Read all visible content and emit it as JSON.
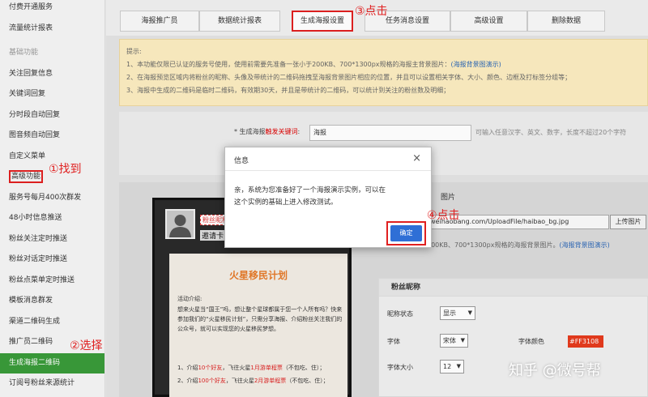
{
  "sidebar": {
    "items": [
      {
        "label": "付费开通服务"
      },
      {
        "label": "流量统计报表"
      },
      {
        "label": "基础功能"
      },
      {
        "label": "关注回复信息"
      },
      {
        "label": "关键词回复"
      },
      {
        "label": "分时段自动回复"
      },
      {
        "label": "图音频自动回复"
      },
      {
        "label": "自定义菜单"
      },
      {
        "label": "高级功能"
      },
      {
        "label": "服务号每月400次群发"
      },
      {
        "label": "48小时信息推送"
      },
      {
        "label": "粉丝关注定时推送"
      },
      {
        "label": "粉丝对话定时推送"
      },
      {
        "label": "粉丝点菜单定时推送"
      },
      {
        "label": "模板消息群发"
      },
      {
        "label": "渠道二维码生成"
      },
      {
        "label": "推广员二维码"
      },
      {
        "label": "生成海报二维码"
      },
      {
        "label": "订阅号粉丝来源统计"
      }
    ]
  },
  "tabs": [
    {
      "label": "海报推广员"
    },
    {
      "label": "数据统计报表"
    },
    {
      "label": "生成海报设置"
    },
    {
      "label": "任务消息设置"
    },
    {
      "label": "高级设置"
    },
    {
      "label": "删除数据"
    }
  ],
  "notice": {
    "title": "提示:",
    "line1": "1、本功能仅限已认证的服务号使用，使用前需要先准备一张小于200KB、700*1300px规格的海报主背景图片：",
    "line1_link": "(海报背景图演示)",
    "line2": "2、在海报预览区域内将粉丝的昵称、头像及带统计的二维码拖拽至海报背景图片相应的位置，并且可以设置相关字体、大小、颜色、边框及打标签分组等；",
    "line3": "3、海报中生成的二维码是临时二维码，有效期30天，并且是带统计的二维码，可以统计到关注的粉丝数及明细；"
  },
  "keyword": {
    "label_prefix": "* 生成海报",
    "label_highlight": "触发关键词",
    "label_suffix": ":",
    "value": "海报",
    "hint": "可输入任意汉字、英文、数字，长度不超过20个字符"
  },
  "background": {
    "label": "图片",
    "url": "weihaobang.com/UploadFile/haibao_bg.jpg",
    "upload_label": "上传图片",
    "size_hint": "200KB、700*1300px规格的海报背景图片。",
    "size_link": "(海报背景图演示)"
  },
  "poster": {
    "nickname": "粉丝昵称",
    "invite": "邀请卡",
    "title": "火星移民计划",
    "intro_label": "活动介绍:",
    "intro_text": "想来火星当“国王”吗，想让整个星球都属于您一个人所有吗？快来参加我们的“火星移民计划”，只需分享海报、介绍粉丝关注我们的公众号，就可以实现您的火星移民梦想。",
    "item1_pre": "1、介绍",
    "item1_hl": "10个好友",
    "item1_mid": "，飞往火星",
    "item1_hl2": "1月游单程票",
    "item1_suf": "（不包吃、住）；",
    "item2_pre": "2、介绍",
    "item2_hl": "100个好友",
    "item2_mid": "，飞往火星",
    "item2_hl2": "2月游单程票",
    "item2_suf": "（不包吃、住）；"
  },
  "fans": {
    "title": "粉丝昵称",
    "status_label": "昵称状态",
    "status_value": "显示",
    "font_label": "字体",
    "font_value": "宋体",
    "color_label": "字体颜色",
    "color_value": "#FF3108",
    "size_label": "字体大小",
    "size_value": "12"
  },
  "modal": {
    "title": "信息",
    "close": "×",
    "line1": "亲，系统为您准备好了一个海报演示实例，可以在",
    "line2": "这个实例的基础上进入修改测试。",
    "ok_label": "确定"
  },
  "annotations": {
    "a1": "①找到",
    "a2": "②选择",
    "a3": "③点击",
    "a4": "④点击"
  },
  "watermark": "知乎 @微号帮",
  "colors": {
    "accent_red": "#e02020",
    "active_green": "#3a9b3a",
    "ok_blue": "#2f6fd6",
    "notice_bg": "#fbecc0"
  }
}
